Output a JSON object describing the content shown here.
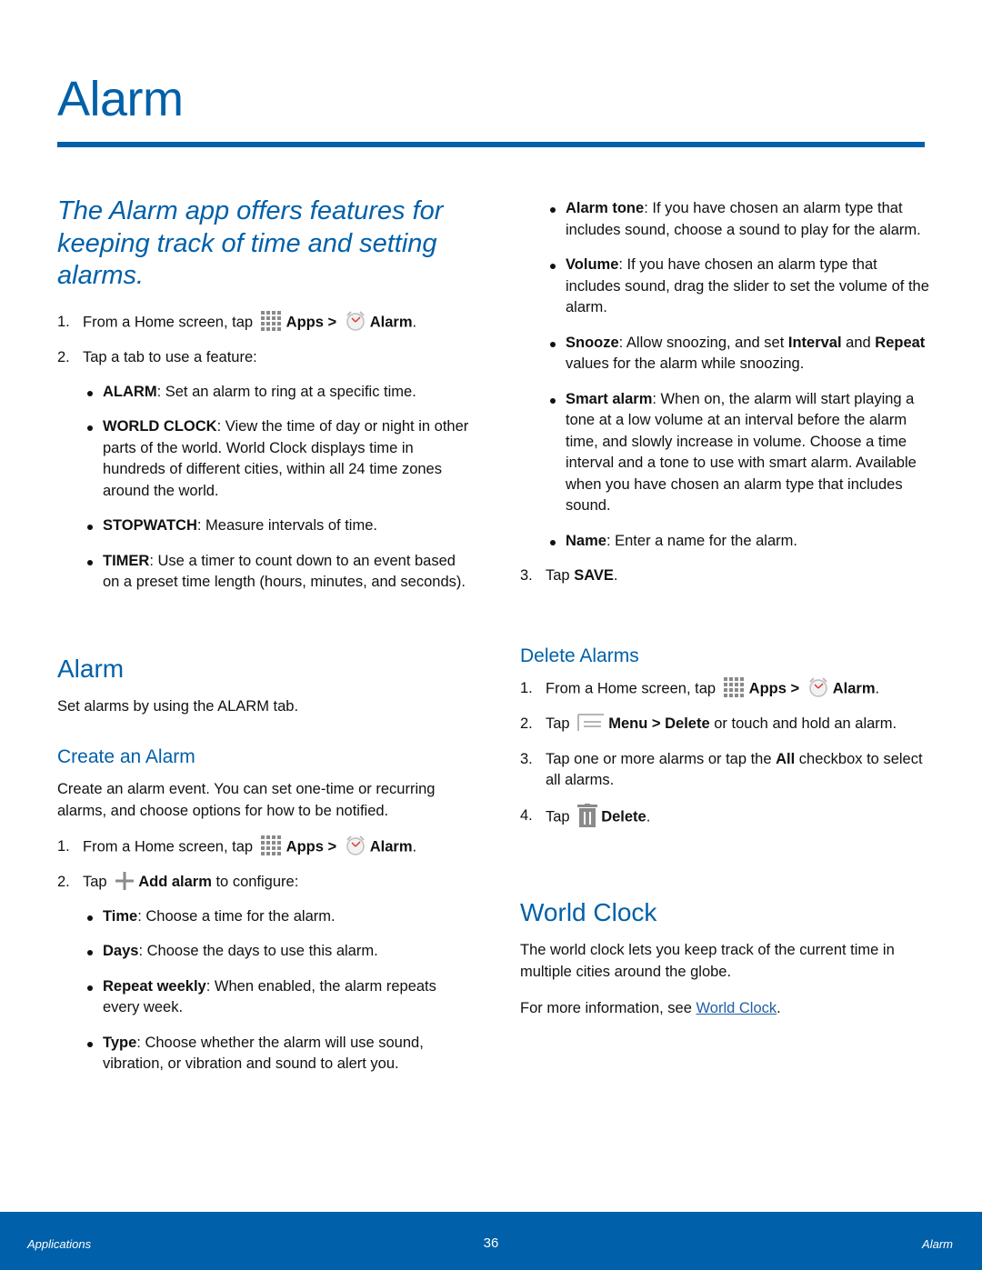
{
  "header": {
    "title": "Alarm",
    "intro": "The Alarm app offers features for keeping track of time and setting alarms."
  },
  "colors": {
    "accent": "#0060a9",
    "link": "#1f5fa8",
    "text": "#111111",
    "icon_gray": "#8a8a8a"
  },
  "overview": {
    "steps": [
      {
        "num": "1.",
        "pre": "From a Home screen, tap",
        "apps": "Apps",
        "sep": ">",
        "alarm": "Alarm",
        "post": "."
      },
      {
        "num": "2.",
        "text": "Tap a tab to use a feature:"
      }
    ],
    "features": [
      {
        "term": "ALARM",
        "desc": ": Set an alarm to ring at a specific time."
      },
      {
        "term": "WORLD CLOCK",
        "desc": ": View the time of day or night in other parts of the world. World Clock displays time in hundreds of different cities, within all 24 time zones around the world."
      },
      {
        "term": "STOPWATCH",
        "desc": ": Measure intervals of time."
      },
      {
        "term": "TIMER",
        "desc": ": Use a timer to count down to an event based on a preset time length (hours, minutes, and seconds)."
      }
    ]
  },
  "alarm_section": {
    "heading": "Alarm",
    "text": "Set alarms by using the ALARM tab."
  },
  "create_section": {
    "heading": "Create an Alarm",
    "text": "Create an alarm event. You can set one-time or recurring alarms, and choose options for how to be notified.",
    "step1": {
      "num": "1.",
      "pre": "From a Home screen, tap",
      "apps": "Apps",
      "sep": ">",
      "alarm": "Alarm",
      "post": "."
    },
    "step2": {
      "num": "2.",
      "pre": "Tap",
      "action": "Add alarm",
      "post": " to configure:"
    },
    "options": [
      {
        "term": "Time",
        "desc": ": Choose a time for the alarm."
      },
      {
        "term": "Days",
        "desc": ": Choose the days to use this alarm."
      },
      {
        "term": "Repeat weekly",
        "desc": ": When enabled, the alarm repeats every week."
      },
      {
        "term": "Type",
        "desc": ": Choose whether the alarm will use sound, vibration, or vibration and sound to alert you."
      }
    ],
    "options_right": [
      {
        "term": "Alarm tone",
        "desc": ": If you have chosen an alarm type that includes sound, choose a sound to play for the alarm."
      },
      {
        "term": "Volume",
        "desc": ": If you have chosen an alarm type that includes sound, drag the slider to set the volume of the alarm."
      },
      {
        "term": "Snooze",
        "desc1": ": Allow snoozing, and set ",
        "term2": "Interval",
        "desc2": " and ",
        "term3": "Repeat",
        "desc3": " values for the alarm while snoozing."
      },
      {
        "term": "Smart alarm",
        "desc": ": When on, the alarm will start playing a tone at a low volume at an interval before the alarm time, and slowly increase in volume. Choose a time interval and a tone to use with smart alarm. Available when you have chosen an alarm type that includes sound."
      },
      {
        "term": "Name",
        "desc": ": Enter a name for the alarm."
      }
    ],
    "step3": {
      "num": "3.",
      "pre": "Tap ",
      "action": "SAVE",
      "post": "."
    }
  },
  "delete_section": {
    "heading": "Delete Alarms",
    "step1": {
      "num": "1.",
      "pre": "From a Home screen, tap",
      "apps": "Apps",
      "sep": ">",
      "alarm": "Alarm",
      "post": "."
    },
    "step2": {
      "num": "2.",
      "pre": "Tap",
      "menu": "Menu",
      "sep": ">",
      "delete": "Delete",
      "post": " or touch and hold an alarm."
    },
    "step3": {
      "num": "3.",
      "pre": "Tap one or more alarms or tap the ",
      "all": "All",
      "post": " checkbox to select all alarms."
    },
    "step4": {
      "num": "4.",
      "pre": "Tap",
      "delete": "Delete",
      "post": "."
    }
  },
  "world_clock_section": {
    "heading": "World Clock",
    "text": "The world clock lets you keep track of the current time in multiple cities around the globe.",
    "more_pre": "For more information, see ",
    "more_link": "World Clock",
    "more_post": "."
  },
  "footer": {
    "section": "Applications",
    "page": "36",
    "chapter": "Alarm"
  }
}
